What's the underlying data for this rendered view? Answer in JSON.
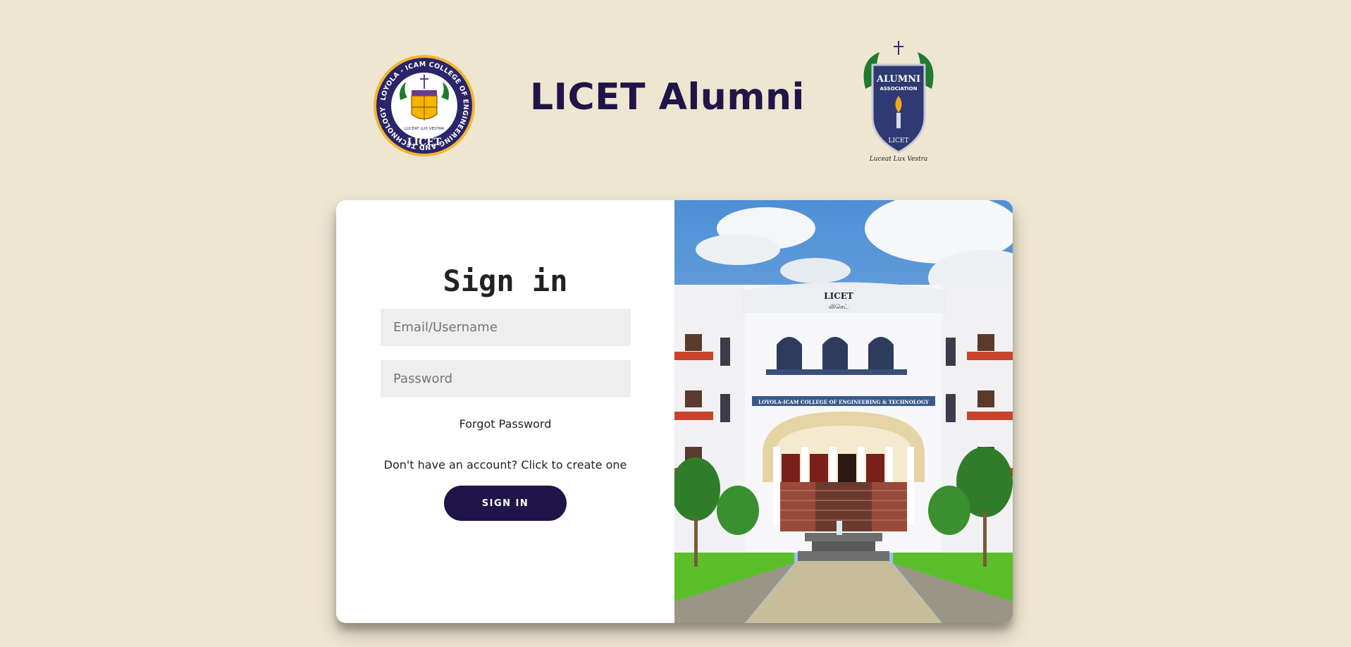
{
  "header": {
    "title": "LICET Alumni",
    "left_logo": {
      "ring_text": "LOYOLA - ICAM COLLEGE OF ENGINEERING AND TECHNOLOGY",
      "motto": "LUCEAT LUX VESTRA",
      "name": "LICET"
    },
    "right_logo": {
      "line1": "ALUMNI",
      "line2": "ASSOCIATION",
      "name": "LICET",
      "motto": "Luceat Lux Vestra"
    }
  },
  "signin": {
    "heading": "Sign in",
    "email_placeholder": "Email/Username",
    "email_value": "",
    "password_placeholder": "Password",
    "password_value": "",
    "forgot_label": "Forgot Password",
    "create_account_label": "Don't have an account? Click to create one",
    "button_label": "SIGN IN"
  },
  "campus_photo": {
    "building_sign": "LICET",
    "building_sign_tamil": "லிசெட்",
    "facade_banner": "LOYOLA-ICAM COLLEGE OF ENGINEERING & TECHNOLOGY"
  },
  "colors": {
    "background": "#efe6d1",
    "brand_navy": "#1f1548",
    "input_bg": "#eeeeee",
    "card_bg": "#ffffff"
  }
}
